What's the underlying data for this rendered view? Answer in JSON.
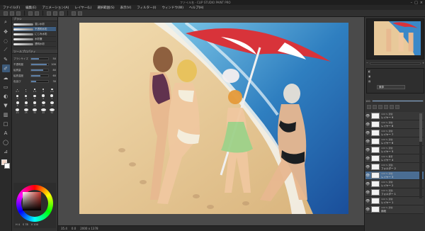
{
  "window": {
    "title": "ファイル名 - CLIP STUDIO PAINT PRO"
  },
  "menu": [
    "ファイル(F)",
    "編集(E)",
    "アニメーション(A)",
    "レイヤー(L)",
    "選択範囲(S)",
    "表示(V)",
    "フィルター(I)",
    "ウィンドウ(W)",
    "ヘルプ(H)"
  ],
  "tools": [
    "brush-icon",
    "eyedropper-icon",
    "move-icon",
    "lasso-icon",
    "pen-icon",
    "eraser-icon",
    "fill-icon",
    "text-icon",
    "gradient-icon",
    "shape-icon",
    "hand-icon",
    "zoom-icon"
  ],
  "colors": {
    "main": "#f5d7c8",
    "sub": "#ffffff",
    "accent": "#4a6d93"
  },
  "brush_panel": {
    "header": "ブラシ",
    "brushes": [
      {
        "name": "濃い水彩"
      },
      {
        "name": "不透明水彩"
      },
      {
        "name": "にじみ水彩"
      },
      {
        "name": "水彩筆"
      },
      {
        "name": "透明水彩"
      }
    ]
  },
  "tool_properties": {
    "header": "ツールプロパティ",
    "items": [
      {
        "label": "ブラシサイズ",
        "value": "50",
        "level": 0.45
      },
      {
        "label": "不透明度",
        "value": "100",
        "level": 0.9
      },
      {
        "label": "絵具量",
        "value": "80",
        "level": 0.7
      },
      {
        "label": "絵具濃度",
        "value": "60",
        "level": 0.55
      },
      {
        "label": "色延び",
        "value": "30",
        "level": 0.3
      }
    ]
  },
  "brush_sizes": [
    "0.7",
    "1",
    "1.5",
    "2",
    "2.5",
    "3",
    "4",
    "5",
    "6",
    "7",
    "8",
    "10",
    "12",
    "15",
    "17",
    "20",
    "25",
    "30",
    "40",
    "50"
  ],
  "color_readout": {
    "h": "H 4",
    "s": "S 78",
    "v": "V 100"
  },
  "status": {
    "zoom": "35.4",
    "angle": "0.0",
    "coords": "2000 x 1378"
  },
  "layer_panel": {
    "blend_mode": "乗算",
    "opacity": "100",
    "opacity_level": 1.0,
    "layers": [
      {
        "name": "レイヤー 9",
        "mode": "100 % 通常"
      },
      {
        "name": "レイヤー 8",
        "mode": "100 % 通常"
      },
      {
        "name": "レイヤー 7",
        "mode": "100 % 通常"
      },
      {
        "name": "レイヤー 6",
        "mode": "100 % 通常"
      },
      {
        "name": "レイヤー 5",
        "mode": "100 % 通常"
      },
      {
        "name": "レイヤー 4",
        "mode": "100 % 乗算"
      },
      {
        "name": "フォルダー 2",
        "mode": "100 % 通過"
      },
      {
        "name": "レイヤー 3",
        "mode": "100 % 通常"
      },
      {
        "name": "レイヤー 2",
        "mode": "100 % 通常"
      },
      {
        "name": "フォルダー 1",
        "mode": "100 % 通過"
      },
      {
        "name": "レイヤー 1",
        "mode": "100 % 通常"
      },
      {
        "name": "用紙",
        "mode": "100 % 通常"
      }
    ]
  }
}
